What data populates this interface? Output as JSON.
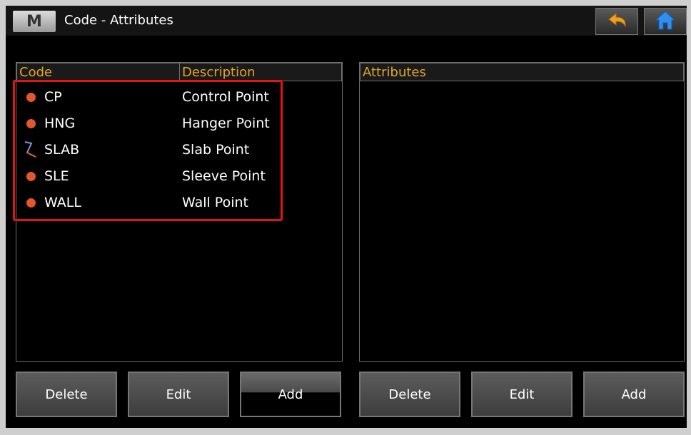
{
  "window": {
    "title": "Code - Attributes",
    "logo_text": "M"
  },
  "toolbar": {
    "back_icon": "undo-arrow-icon",
    "home_icon": "home-icon"
  },
  "codes_panel": {
    "headers": {
      "code": "Code",
      "description": "Description"
    },
    "rows": [
      {
        "code": "CP",
        "description": "Control Point",
        "icon": "point-dot-icon"
      },
      {
        "code": "HNG",
        "description": "Hanger Point",
        "icon": "point-dot-icon"
      },
      {
        "code": "SLAB",
        "description": "Slab Point",
        "icon": "line-icon"
      },
      {
        "code": "SLE",
        "description": "Sleeve Point",
        "icon": "point-dot-icon"
      },
      {
        "code": "WALL",
        "description": "Wall Point",
        "icon": "point-dot-icon"
      }
    ]
  },
  "attributes_panel": {
    "header": "Attributes"
  },
  "buttons": {
    "left": {
      "delete": "Delete",
      "edit": "Edit",
      "add": "Add"
    },
    "right": {
      "delete": "Delete",
      "edit": "Edit",
      "add": "Add"
    }
  },
  "colors": {
    "header_text": "#e3a52a",
    "point_dot": "#e2582a",
    "highlight": "#e41414"
  }
}
